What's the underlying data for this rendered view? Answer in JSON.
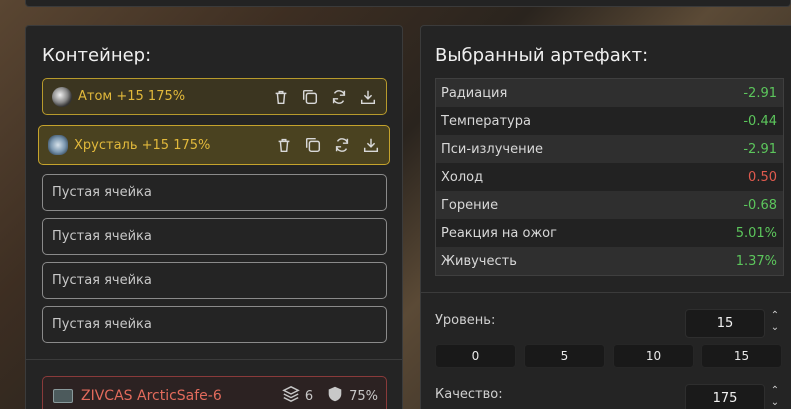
{
  "container_panel": {
    "title": "Контейнер:",
    "slots": [
      {
        "label": "Атом +15 175%",
        "icon": "atom-icon",
        "filled": true
      },
      {
        "label": "Хрусталь +15 175%",
        "icon": "crystal-icon",
        "filled": true
      },
      {
        "label": "Пустая ячейка",
        "filled": false
      },
      {
        "label": "Пустая ячейка",
        "filled": false
      },
      {
        "label": "Пустая ячейка",
        "filled": false
      },
      {
        "label": "Пустая ячейка",
        "filled": false
      }
    ],
    "container": {
      "name": "ZIVCAS ArcticSafe-6",
      "slots_count": "6",
      "protection": "75%"
    }
  },
  "artifact_panel": {
    "title": "Выбранный артефакт:",
    "stats": [
      {
        "name": "Радиация",
        "value": "-2.91",
        "tone": "good"
      },
      {
        "name": "Температура",
        "value": "-0.44",
        "tone": "good"
      },
      {
        "name": "Пси-излучение",
        "value": "-2.91",
        "tone": "good"
      },
      {
        "name": "Холод",
        "value": "0.50",
        "tone": "bad"
      },
      {
        "name": "Горение",
        "value": "-0.68",
        "tone": "good"
      },
      {
        "name": "Реакция на ожог",
        "value": "5.01%",
        "tone": "good"
      },
      {
        "name": "Живучесть",
        "value": "1.37%",
        "tone": "good"
      }
    ],
    "level": {
      "label": "Уровень:",
      "value": "15",
      "presets": [
        "0",
        "5",
        "10",
        "15"
      ]
    },
    "quality": {
      "label": "Качество:",
      "value": "175"
    }
  },
  "colors": {
    "accent_gold": "#e2b93b",
    "positive": "#5cc65c",
    "negative": "#e05a4e",
    "container_red": "#e36b5c"
  }
}
